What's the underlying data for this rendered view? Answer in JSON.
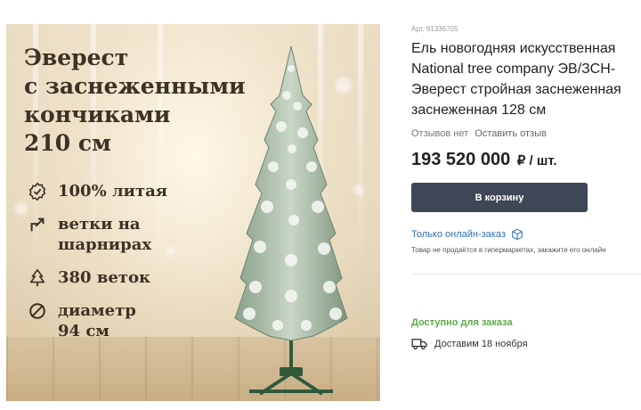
{
  "promo": {
    "title_lines": [
      "Эверест",
      "с заснеженными",
      "кончиками",
      "210 см"
    ],
    "features": [
      {
        "icon": "badge-check-icon",
        "lines": [
          "100% литая"
        ]
      },
      {
        "icon": "hinge-arrow-icon",
        "lines": [
          "ветки на",
          "шарнирах"
        ]
      },
      {
        "icon": "tree-icon",
        "lines": [
          "380 веток"
        ]
      },
      {
        "icon": "diameter-icon",
        "lines": [
          "диаметр",
          "94 см"
        ]
      }
    ]
  },
  "product": {
    "sku": "Арт. 91336705",
    "title_lines": [
      "Ель новогодняя искусственная",
      "National tree company ЭВ/ЗСН-",
      "Эверест стройная заснеженная",
      "заснеженная 128 см"
    ],
    "reviews": "Отзывов нет",
    "write_review": "Оставить отзыв",
    "price": "193 520 000",
    "price_unit": "₽ / шт.",
    "cart_button": "В корзину",
    "online_only": "Только онлайн-заказ",
    "online_note": "Товар не продаётся в гипермаркетах, закажите его онлайн",
    "availability": "Доступно для заказа",
    "delivery": "Доставим 18 ноября"
  },
  "colors": {
    "accent": "#3f4655",
    "link": "#2f6fb5",
    "available": "#5fa84a",
    "promo_text": "#3f3125"
  }
}
